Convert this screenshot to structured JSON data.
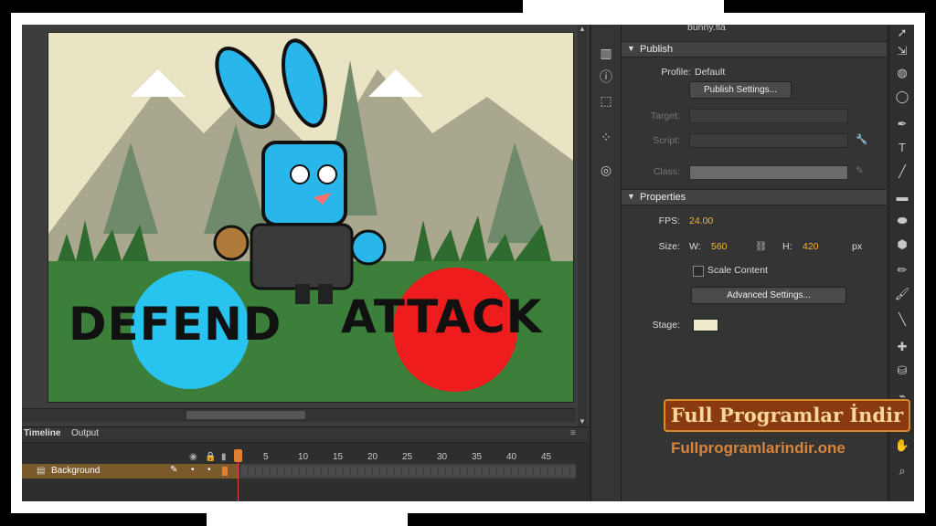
{
  "document": {
    "filename": "bunny.fla"
  },
  "publish": {
    "header": "Publish",
    "profile_label": "Profile:",
    "profile_value": "Default",
    "publish_settings_button": "Publish Settings...",
    "target_label": "Target:",
    "script_label": "Script:",
    "class_label": "Class:"
  },
  "properties": {
    "header": "Properties",
    "fps_label": "FPS:",
    "fps_value": "24.00",
    "size_label": "Size:",
    "w_label": "W:",
    "w_value": "560",
    "h_label": "H:",
    "h_value": "420",
    "units": "px",
    "scale_content_label": "Scale Content",
    "advanced_settings_button": "Advanced Settings...",
    "stage_label": "Stage:",
    "stage_color": "#eeebcc"
  },
  "stage_art": {
    "defend_text": "DEFEND",
    "attack_text": "ATTACK",
    "defend_color": "#29c3ef",
    "attack_color": "#ee1c1c"
  },
  "timeline": {
    "tabs": [
      "Timeline",
      "Output"
    ],
    "frame_numbers": [
      "1",
      "5",
      "10",
      "15",
      "20",
      "25",
      "30",
      "35",
      "40",
      "45"
    ],
    "layer_name": "Background"
  },
  "watermark": {
    "title": "Full Programlar İndir",
    "url": "Fullprogramlarindir.one"
  },
  "icons": {
    "toolstrip": [
      "library-icon",
      "info-icon",
      "transform-icon",
      "color-icon",
      "cc-libraries-icon"
    ],
    "right_tools": [
      "selection-icon",
      "subselection-icon",
      "free-transform-icon",
      "3d-rotation-icon",
      "lasso-icon",
      "pen-icon",
      "text-icon",
      "line-icon",
      "rectangle-icon",
      "oval-icon",
      "polystar-icon",
      "pencil-icon",
      "paint-brush-icon",
      "brush-icon",
      "bone-icon",
      "paint-bucket-icon",
      "eyedropper-icon",
      "eraser-icon",
      "hand-icon",
      "zoom-icon"
    ]
  }
}
